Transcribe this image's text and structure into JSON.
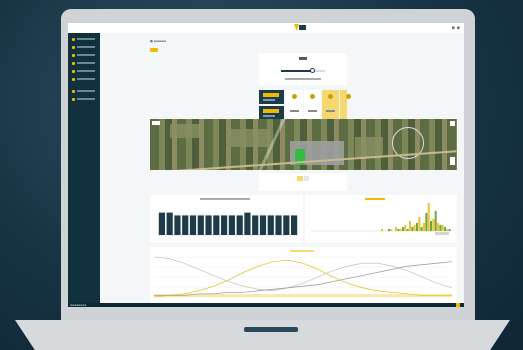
{
  "app": {
    "accent_color": "#f0b800",
    "dark_color": "#1d3c4a",
    "logo_icon": "vm-logo-icon"
  },
  "sidebar": {
    "icons": [
      "home-icon",
      "folder-icon",
      "map-icon",
      "chart-icon",
      "device-icon",
      "weather-icon",
      "settings-icon",
      "user-icon"
    ]
  },
  "control": {
    "slider_fraction": 0.7
  },
  "stats": {
    "icons": [
      "thermometer-icon",
      "wind-icon",
      "rain-icon",
      "sun-icon"
    ]
  },
  "chart_data": [
    {
      "type": "bar",
      "values": [
        8,
        8,
        7,
        7,
        7,
        7,
        7,
        7,
        7,
        7,
        7,
        8,
        7,
        7,
        7,
        7,
        7,
        7
      ],
      "color": "#1d3c4a"
    },
    {
      "type": "bar",
      "series": [
        {
          "values": [
            0,
            0,
            0,
            0,
            0,
            0,
            0,
            0,
            0,
            0,
            0,
            0,
            0,
            0,
            0,
            1,
            0,
            1,
            2,
            1,
            3,
            5,
            3,
            7,
            4,
            14,
            6,
            4,
            3,
            1
          ],
          "color": "#e8c430"
        },
        {
          "values": [
            0,
            0,
            0,
            0,
            0,
            0,
            0,
            0,
            0,
            0,
            0,
            0,
            0,
            0,
            0,
            0,
            1,
            0,
            1,
            2,
            1,
            2,
            4,
            2,
            9,
            5,
            10,
            3,
            2,
            1
          ],
          "color": "#6fa83a"
        }
      ]
    },
    {
      "type": "line",
      "series": [
        {
          "values": [
            0,
            1,
            2,
            4,
            7,
            11,
            16,
            20,
            23,
            24,
            22,
            18,
            13,
            9,
            6,
            4,
            3,
            2,
            1,
            1,
            1
          ],
          "color": "#e8c430"
        },
        {
          "values": [
            26,
            25,
            22,
            18,
            14,
            10,
            7,
            5,
            4,
            6,
            9,
            13,
            17,
            20,
            22,
            22,
            20,
            17,
            13,
            9,
            6
          ],
          "color": "#c8c8c8"
        },
        {
          "values": [
            1,
            1,
            1,
            2,
            2,
            3,
            3,
            4,
            5,
            6,
            7,
            8,
            10,
            12,
            14,
            16,
            18,
            20,
            21,
            22,
            23
          ],
          "color": "#9aa4a8"
        }
      ]
    }
  ]
}
